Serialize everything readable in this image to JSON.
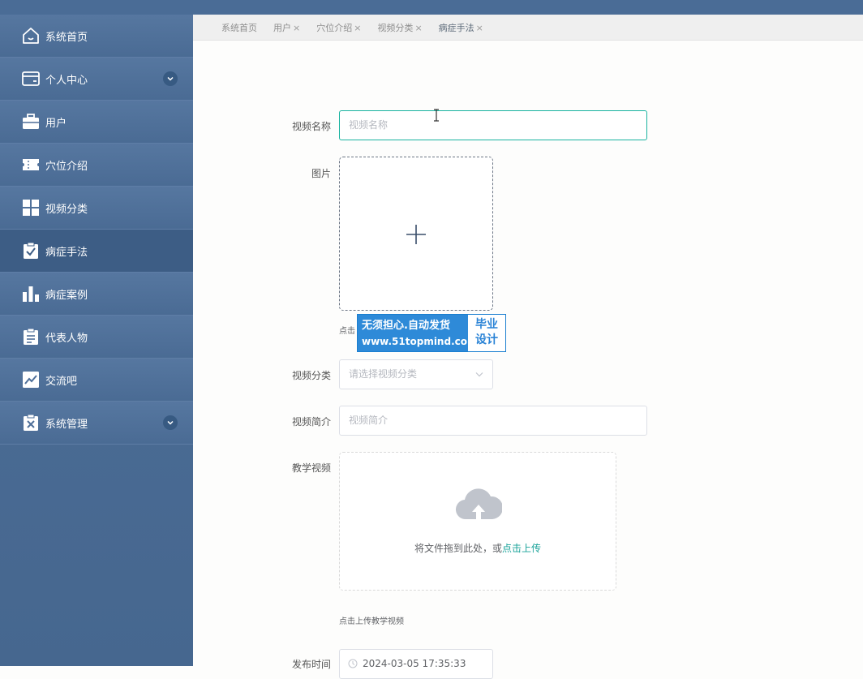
{
  "sidebar": {
    "items": [
      {
        "label": "系统首页",
        "icon": "home-icon"
      },
      {
        "label": "个人中心",
        "icon": "card-icon",
        "expandable": true
      },
      {
        "label": "用户",
        "icon": "briefcase-icon"
      },
      {
        "label": "穴位介绍",
        "icon": "ticket-icon"
      },
      {
        "label": "视频分类",
        "icon": "grid-icon"
      },
      {
        "label": "病症手法",
        "icon": "clipboard-check-icon",
        "active": true
      },
      {
        "label": "病症案例",
        "icon": "bar-chart-icon"
      },
      {
        "label": "代表人物",
        "icon": "clipboard-list-icon"
      },
      {
        "label": "交流吧",
        "icon": "trend-chart-icon"
      },
      {
        "label": "系统管理",
        "icon": "clipboard-x-icon",
        "expandable": true
      }
    ]
  },
  "tabs": [
    {
      "label": "系统首页",
      "closable": false
    },
    {
      "label": "用户",
      "closable": true
    },
    {
      "label": "穴位介绍",
      "closable": true
    },
    {
      "label": "视频分类",
      "closable": true
    },
    {
      "label": "病症手法",
      "closable": true,
      "active": true
    }
  ],
  "tab_close": "×",
  "form": {
    "video_name": {
      "label": "视频名称",
      "placeholder": "视频名称"
    },
    "image": {
      "label": "图片",
      "hint": "点击"
    },
    "category": {
      "label": "视频分类",
      "placeholder": "请选择视频分类"
    },
    "intro": {
      "label": "视频简介",
      "placeholder": "视频简介"
    },
    "teaching_video": {
      "label": "教学视频",
      "drop_text": "将文件拖到此处，或",
      "drop_link": "点击上传",
      "hint": "点击上传教学视频"
    },
    "publish_time": {
      "label": "发布时间",
      "value": "2024-03-05 17:35:33"
    }
  },
  "watermark": {
    "line1": "无须担心.自动发货",
    "line2": "www.51topmind.com",
    "right1": "毕业",
    "right2": "设计"
  },
  "colors": {
    "accent": "#19b3a0",
    "sidebar": "#4e6f99",
    "active": "#3d5d85"
  }
}
